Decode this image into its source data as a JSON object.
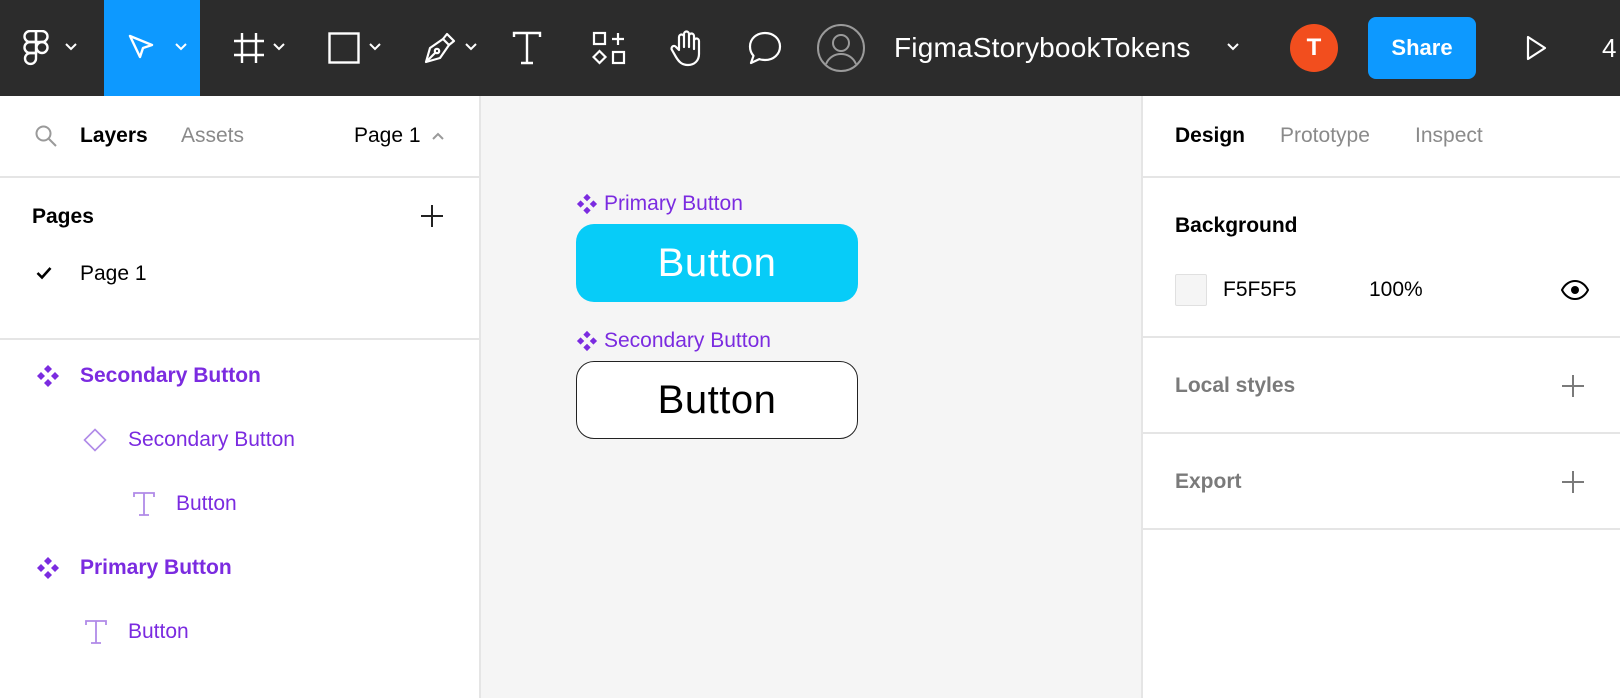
{
  "toolbar": {
    "file_name": "FigmaStorybookTokens",
    "avatar_initial": "T",
    "share_label": "Share",
    "zoom_partial": "4",
    "icons": [
      "figma-logo-icon",
      "move-tool-icon",
      "frame-tool-icon",
      "rectangle-tool-icon",
      "pen-tool-icon",
      "text-tool-icon",
      "resources-icon",
      "hand-tool-icon",
      "comment-icon",
      "user-icon",
      "present-icon"
    ],
    "colors": {
      "bg": "#2c2c2c",
      "active": "#0d99ff",
      "avatar": "#f24e1e"
    }
  },
  "left_panel": {
    "tabs": {
      "layers": "Layers",
      "assets": "Assets",
      "page_selector": "Page 1"
    },
    "pages": {
      "title": "Pages",
      "items": [
        {
          "label": "Page 1",
          "checked": true
        }
      ]
    },
    "layers": [
      {
        "label": "Secondary Button",
        "type": "component-set",
        "depth": 0
      },
      {
        "label": "Secondary Button",
        "type": "variant",
        "depth": 1
      },
      {
        "label": "Button",
        "type": "text",
        "depth": 2
      },
      {
        "label": "Primary Button",
        "type": "component-set",
        "depth": 0
      },
      {
        "label": "Button",
        "type": "text",
        "depth": 1
      }
    ],
    "component_color": "#7b2be0"
  },
  "canvas": {
    "background": "#f5f5f5",
    "primary": {
      "label": "Primary Button",
      "button_text": "Button",
      "fill": "#07ccf8"
    },
    "secondary": {
      "label": "Secondary Button",
      "button_text": "Button",
      "fill": "#ffffff"
    }
  },
  "right_panel": {
    "tabs": {
      "design": "Design",
      "prototype": "Prototype",
      "inspect": "Inspect"
    },
    "background": {
      "title": "Background",
      "hex": "F5F5F5",
      "opacity": "100%"
    },
    "local_styles": {
      "title": "Local styles"
    },
    "export": {
      "title": "Export"
    }
  }
}
